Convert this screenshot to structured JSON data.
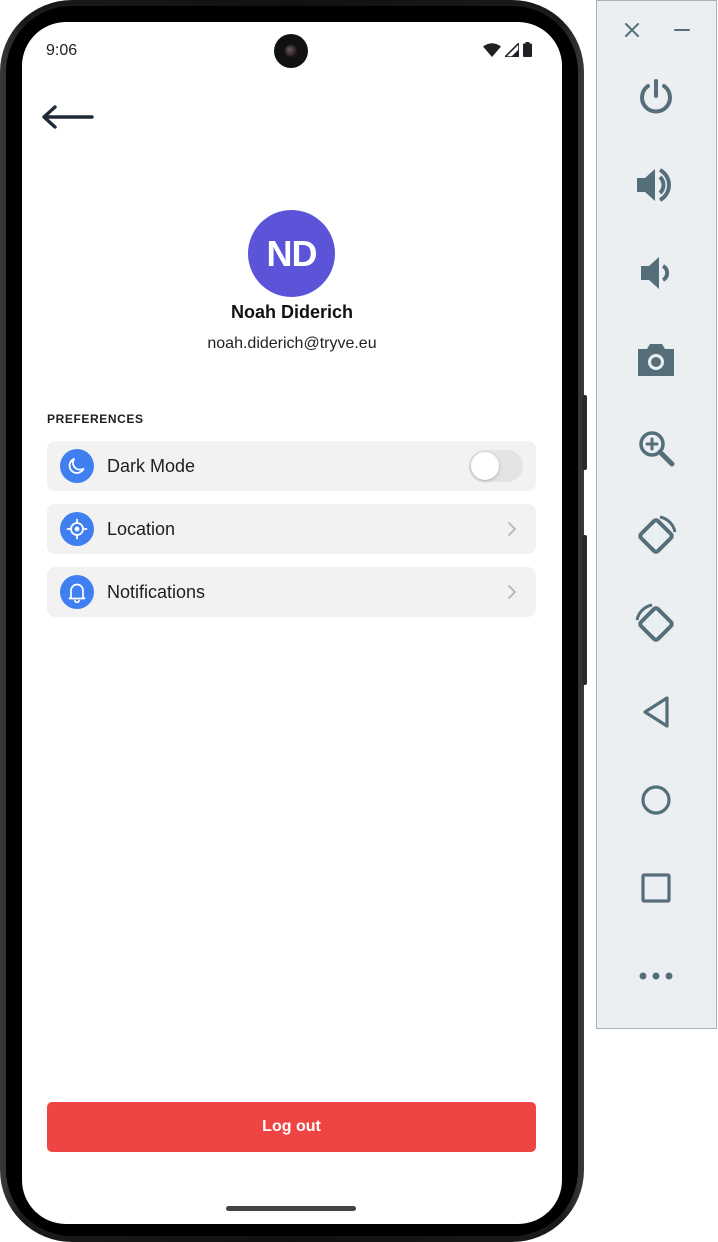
{
  "status_bar": {
    "time": "9:06"
  },
  "profile": {
    "initials": "ND",
    "name": "Noah Diderich",
    "email": "noah.diderich@tryve.eu",
    "avatar_color": "#5b54d9"
  },
  "preferences": {
    "section_title": "PREFERENCES",
    "items": [
      {
        "label": "Dark Mode",
        "icon": "moon-icon",
        "control": "toggle",
        "toggled": false
      },
      {
        "label": "Location",
        "icon": "location-target-icon",
        "control": "chevron"
      },
      {
        "label": "Notifications",
        "icon": "bell-icon",
        "control": "chevron"
      }
    ]
  },
  "actions": {
    "logout_label": "Log out",
    "logout_color": "#ef4444"
  },
  "colors": {
    "accent": "#3f7ff0",
    "toolbar_icon": "#546e7a"
  },
  "emulator_toolbar": {
    "buttons": [
      "power-icon",
      "volume-up-icon",
      "volume-down-icon",
      "screenshot-camera-icon",
      "zoom-icon",
      "rotate-left-icon",
      "rotate-right-icon",
      "back-triangle-icon",
      "home-circle-icon",
      "overview-square-icon",
      "more-dots-icon"
    ]
  }
}
